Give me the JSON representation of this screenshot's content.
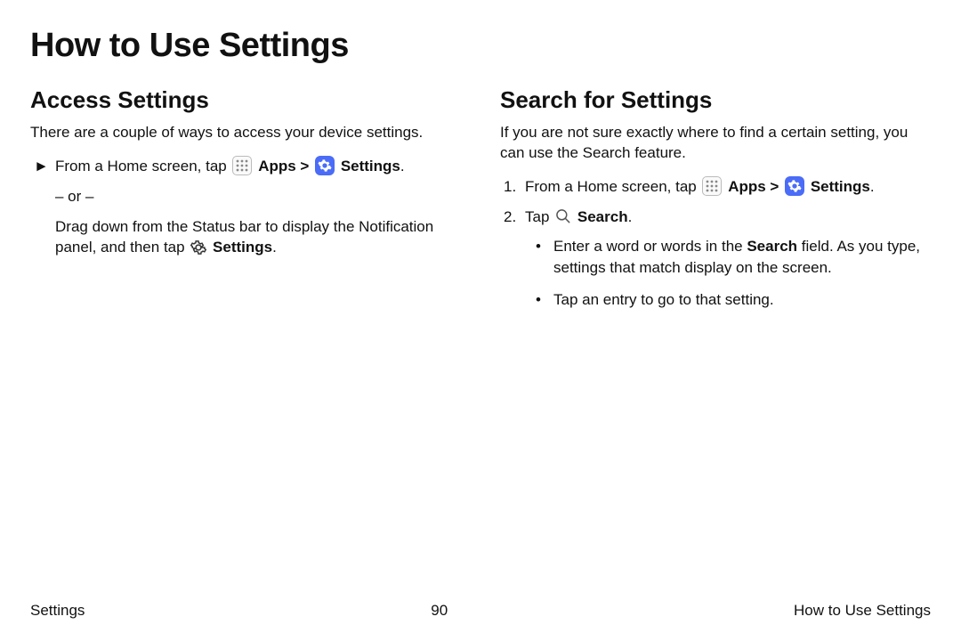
{
  "page_title": "How to Use Settings",
  "left": {
    "heading": "Access Settings",
    "intro": "There are a couple of ways to access your device settings.",
    "step_marker": "►",
    "step_prefix": "From a Home screen, tap ",
    "apps_label": "Apps",
    "chevron": " > ",
    "settings_label": "Settings",
    "period": ".",
    "or_text": "– or –",
    "drag_prefix": "Drag down from the Status bar to display the Notification panel, and then tap ",
    "drag_settings": "Settings",
    "drag_period": "."
  },
  "right": {
    "heading": "Search for Settings",
    "intro": "If you are not sure exactly where to find a certain setting, you can use the Search feature.",
    "step1_marker": "1.",
    "step1_prefix": "From a Home screen, tap ",
    "apps_label": "Apps",
    "chevron": " > ",
    "settings_label": "Settings",
    "period": ".",
    "step2_marker": "2.",
    "step2_prefix": "Tap ",
    "search_label": "Search",
    "step2_period": ".",
    "bullet1_a": "Enter a word or words in the ",
    "bullet1_bold": "Search",
    "bullet1_b": " field. As you type, settings that match display on the screen.",
    "bullet2": "Tap an entry to go to that setting."
  },
  "footer": {
    "left": "Settings",
    "center": "90",
    "right": "How to Use Settings"
  }
}
